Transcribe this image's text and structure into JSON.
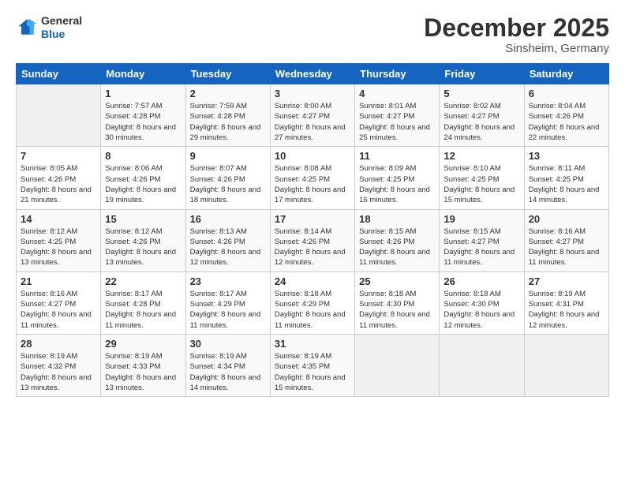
{
  "header": {
    "logo_line1": "General",
    "logo_line2": "Blue",
    "month": "December 2025",
    "location": "Sinsheim, Germany"
  },
  "weekdays": [
    "Sunday",
    "Monday",
    "Tuesday",
    "Wednesday",
    "Thursday",
    "Friday",
    "Saturday"
  ],
  "weeks": [
    [
      {
        "day": "",
        "sunrise": "",
        "sunset": "",
        "daylight": ""
      },
      {
        "day": "1",
        "sunrise": "Sunrise: 7:57 AM",
        "sunset": "Sunset: 4:28 PM",
        "daylight": "Daylight: 8 hours and 30 minutes."
      },
      {
        "day": "2",
        "sunrise": "Sunrise: 7:59 AM",
        "sunset": "Sunset: 4:28 PM",
        "daylight": "Daylight: 8 hours and 29 minutes."
      },
      {
        "day": "3",
        "sunrise": "Sunrise: 8:00 AM",
        "sunset": "Sunset: 4:27 PM",
        "daylight": "Daylight: 8 hours and 27 minutes."
      },
      {
        "day": "4",
        "sunrise": "Sunrise: 8:01 AM",
        "sunset": "Sunset: 4:27 PM",
        "daylight": "Daylight: 8 hours and 25 minutes."
      },
      {
        "day": "5",
        "sunrise": "Sunrise: 8:02 AM",
        "sunset": "Sunset: 4:27 PM",
        "daylight": "Daylight: 8 hours and 24 minutes."
      },
      {
        "day": "6",
        "sunrise": "Sunrise: 8:04 AM",
        "sunset": "Sunset: 4:26 PM",
        "daylight": "Daylight: 8 hours and 22 minutes."
      }
    ],
    [
      {
        "day": "7",
        "sunrise": "Sunrise: 8:05 AM",
        "sunset": "Sunset: 4:26 PM",
        "daylight": "Daylight: 8 hours and 21 minutes."
      },
      {
        "day": "8",
        "sunrise": "Sunrise: 8:06 AM",
        "sunset": "Sunset: 4:26 PM",
        "daylight": "Daylight: 8 hours and 19 minutes."
      },
      {
        "day": "9",
        "sunrise": "Sunrise: 8:07 AM",
        "sunset": "Sunset: 4:26 PM",
        "daylight": "Daylight: 8 hours and 18 minutes."
      },
      {
        "day": "10",
        "sunrise": "Sunrise: 8:08 AM",
        "sunset": "Sunset: 4:25 PM",
        "daylight": "Daylight: 8 hours and 17 minutes."
      },
      {
        "day": "11",
        "sunrise": "Sunrise: 8:09 AM",
        "sunset": "Sunset: 4:25 PM",
        "daylight": "Daylight: 8 hours and 16 minutes."
      },
      {
        "day": "12",
        "sunrise": "Sunrise: 8:10 AM",
        "sunset": "Sunset: 4:25 PM",
        "daylight": "Daylight: 8 hours and 15 minutes."
      },
      {
        "day": "13",
        "sunrise": "Sunrise: 8:11 AM",
        "sunset": "Sunset: 4:25 PM",
        "daylight": "Daylight: 8 hours and 14 minutes."
      }
    ],
    [
      {
        "day": "14",
        "sunrise": "Sunrise: 8:12 AM",
        "sunset": "Sunset: 4:25 PM",
        "daylight": "Daylight: 8 hours and 13 minutes."
      },
      {
        "day": "15",
        "sunrise": "Sunrise: 8:12 AM",
        "sunset": "Sunset: 4:26 PM",
        "daylight": "Daylight: 8 hours and 13 minutes."
      },
      {
        "day": "16",
        "sunrise": "Sunrise: 8:13 AM",
        "sunset": "Sunset: 4:26 PM",
        "daylight": "Daylight: 8 hours and 12 minutes."
      },
      {
        "day": "17",
        "sunrise": "Sunrise: 8:14 AM",
        "sunset": "Sunset: 4:26 PM",
        "daylight": "Daylight: 8 hours and 12 minutes."
      },
      {
        "day": "18",
        "sunrise": "Sunrise: 8:15 AM",
        "sunset": "Sunset: 4:26 PM",
        "daylight": "Daylight: 8 hours and 11 minutes."
      },
      {
        "day": "19",
        "sunrise": "Sunrise: 8:15 AM",
        "sunset": "Sunset: 4:27 PM",
        "daylight": "Daylight: 8 hours and 11 minutes."
      },
      {
        "day": "20",
        "sunrise": "Sunrise: 8:16 AM",
        "sunset": "Sunset: 4:27 PM",
        "daylight": "Daylight: 8 hours and 11 minutes."
      }
    ],
    [
      {
        "day": "21",
        "sunrise": "Sunrise: 8:16 AM",
        "sunset": "Sunset: 4:27 PM",
        "daylight": "Daylight: 8 hours and 11 minutes."
      },
      {
        "day": "22",
        "sunrise": "Sunrise: 8:17 AM",
        "sunset": "Sunset: 4:28 PM",
        "daylight": "Daylight: 8 hours and 11 minutes."
      },
      {
        "day": "23",
        "sunrise": "Sunrise: 8:17 AM",
        "sunset": "Sunset: 4:29 PM",
        "daylight": "Daylight: 8 hours and 11 minutes."
      },
      {
        "day": "24",
        "sunrise": "Sunrise: 8:18 AM",
        "sunset": "Sunset: 4:29 PM",
        "daylight": "Daylight: 8 hours and 11 minutes."
      },
      {
        "day": "25",
        "sunrise": "Sunrise: 8:18 AM",
        "sunset": "Sunset: 4:30 PM",
        "daylight": "Daylight: 8 hours and 11 minutes."
      },
      {
        "day": "26",
        "sunrise": "Sunrise: 8:18 AM",
        "sunset": "Sunset: 4:30 PM",
        "daylight": "Daylight: 8 hours and 12 minutes."
      },
      {
        "day": "27",
        "sunrise": "Sunrise: 8:19 AM",
        "sunset": "Sunset: 4:31 PM",
        "daylight": "Daylight: 8 hours and 12 minutes."
      }
    ],
    [
      {
        "day": "28",
        "sunrise": "Sunrise: 8:19 AM",
        "sunset": "Sunset: 4:32 PM",
        "daylight": "Daylight: 8 hours and 13 minutes."
      },
      {
        "day": "29",
        "sunrise": "Sunrise: 8:19 AM",
        "sunset": "Sunset: 4:33 PM",
        "daylight": "Daylight: 8 hours and 13 minutes."
      },
      {
        "day": "30",
        "sunrise": "Sunrise: 8:19 AM",
        "sunset": "Sunset: 4:34 PM",
        "daylight": "Daylight: 8 hours and 14 minutes."
      },
      {
        "day": "31",
        "sunrise": "Sunrise: 8:19 AM",
        "sunset": "Sunset: 4:35 PM",
        "daylight": "Daylight: 8 hours and 15 minutes."
      },
      {
        "day": "",
        "sunrise": "",
        "sunset": "",
        "daylight": ""
      },
      {
        "day": "",
        "sunrise": "",
        "sunset": "",
        "daylight": ""
      },
      {
        "day": "",
        "sunrise": "",
        "sunset": "",
        "daylight": ""
      }
    ]
  ]
}
